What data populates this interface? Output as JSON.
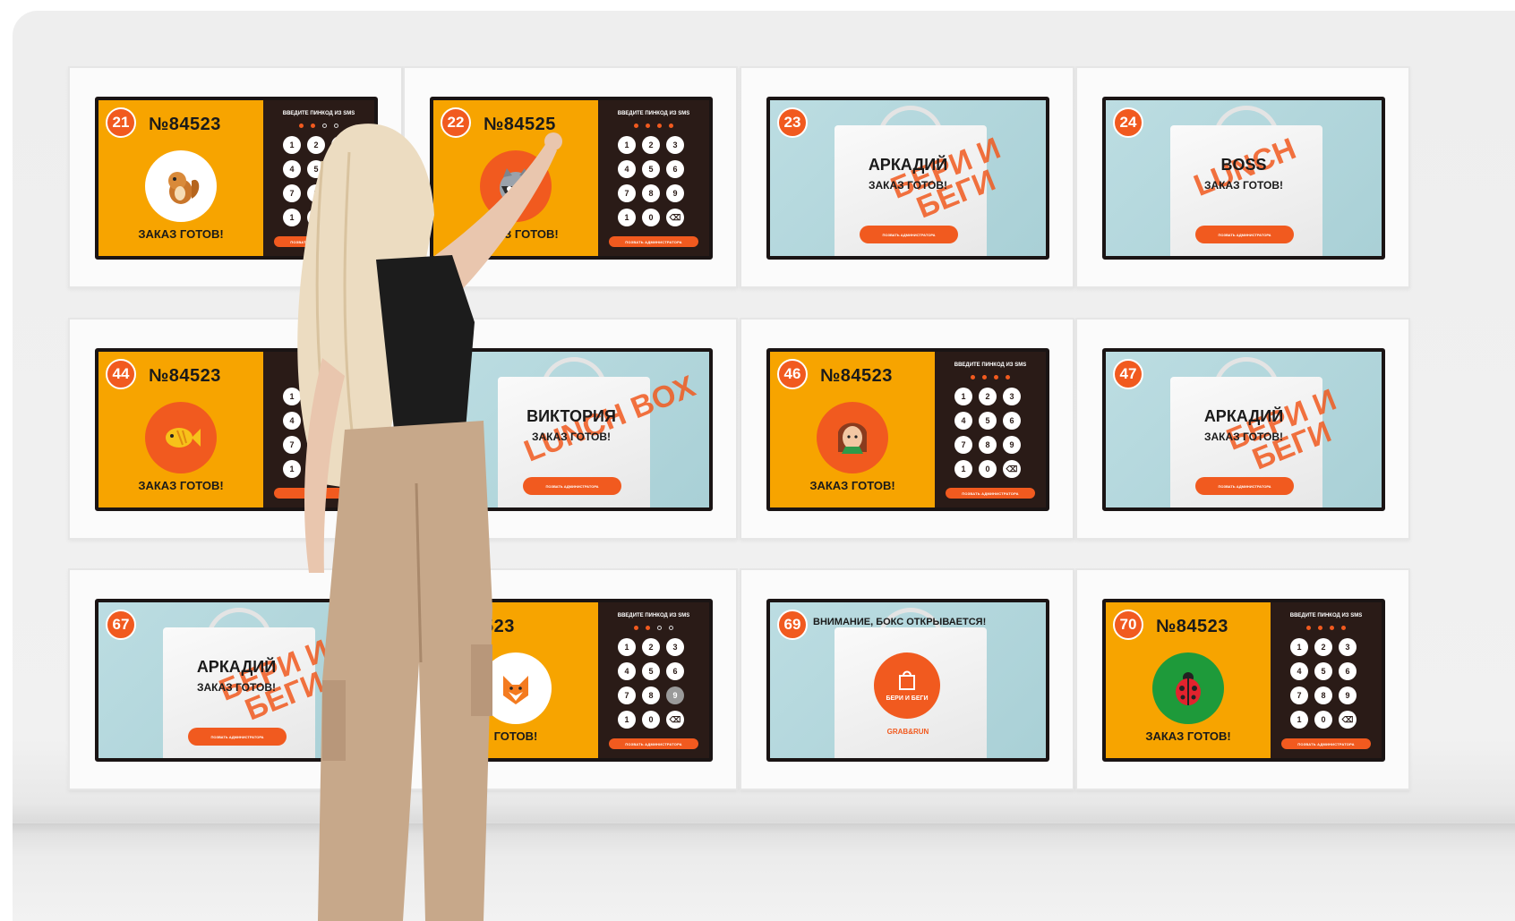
{
  "screens": [
    {
      "type": "order",
      "number": "21",
      "order": "№84523",
      "ready": "ЗАКАЗ ГОТОВ!",
      "avatar": "chipmunk-icon",
      "avatar_bg": "white",
      "pin_title": "ВВЕДИТЕ ПИНКОД ИЗ SMS",
      "dots": [
        1,
        1,
        0,
        0
      ],
      "pressed": "9",
      "admin": "ПОЗВАТЬ АДМИНИСТРАТОРА"
    },
    {
      "type": "order",
      "number": "22",
      "order": "№84525",
      "ready": "ЗАКАЗ ГОТОВ!",
      "avatar": "raccoon-icon",
      "avatar_bg": "orange",
      "pin_title": "ВВЕДИТЕ ПИНКОД ИЗ SMS",
      "dots": [
        1,
        1,
        1,
        1
      ],
      "pressed": "",
      "admin": "ПОЗВАТЬ АДМИНИСТРАТОРА"
    },
    {
      "type": "bag",
      "number": "23",
      "name": "АРКАДИЙ",
      "ready": "ЗАКАЗ ГОТОВ!",
      "brand": "БЕРИ И БЕГИ",
      "admin": "ПОЗВАТЬ АДМИНИСТРАТОРА"
    },
    {
      "type": "bag",
      "number": "24",
      "name": "BOSS",
      "ready": "ЗАКАЗ ГОТОВ!",
      "brand": "LUNCH",
      "admin": "ПОЗВАТЬ АДМИНИСТРАТОРА"
    },
    {
      "type": "order",
      "number": "44",
      "order": "№84523",
      "ready": "ЗАКАЗ ГОТОВ!",
      "avatar": "fish-icon",
      "avatar_bg": "orange",
      "pin_title": "ВВЕДИ",
      "dots": [],
      "pressed": "9",
      "admin": "ПОЗВА"
    },
    {
      "type": "bag",
      "number": "",
      "name": "ВИКТОРИЯ",
      "ready": "ЗАКАЗ ГОТОВ!",
      "brand": "LUNCH BOX",
      "admin": "ПОЗВАТЬ АДМИНИСТРАТОРА"
    },
    {
      "type": "order",
      "number": "46",
      "order": "№84523",
      "ready": "ЗАКАЗ ГОТОВ!",
      "avatar": "elf-icon",
      "avatar_bg": "orange",
      "pin_title": "ВВЕДИТЕ ПИНКОД ИЗ SMS",
      "dots": [
        1,
        1,
        1,
        1
      ],
      "pressed": "",
      "admin": "ПОЗВАТЬ АДМИНИСТРАТОРА"
    },
    {
      "type": "bag",
      "number": "47",
      "name": "АРКАДИЙ",
      "ready": "ЗАКАЗ ГОТОВ!",
      "brand": "БЕРИ И БЕГИ",
      "admin": "ПОЗВАТЬ АДМИНИСТРАТОРА"
    },
    {
      "type": "bag",
      "number": "67",
      "name": "АРКАДИЙ",
      "ready": "ЗАКАЗ ГОТОВ!",
      "brand": "БЕРИ И БЕГИ",
      "admin": "ПОЗВАТЬ АДМИНИСТРАТОРА"
    },
    {
      "type": "order",
      "number": "",
      "order": "523",
      "ready": "ГОТОВ!",
      "avatar": "fox-icon",
      "avatar_bg": "white",
      "pin_title": "ВВЕДИТЕ ПИНКОД ИЗ SMS",
      "dots": [
        1,
        1,
        0,
        0
      ],
      "pressed": "9",
      "admin": "ПОЗВАТЬ АДМИНИСТРАТОРА"
    },
    {
      "type": "opening",
      "number": "69",
      "notice": "ВНИМАНИЕ, БОКС ОТКРЫВАЕТСЯ!",
      "circle_text": "БЕРИ И БЕГИ",
      "brand": "GRAB&RUN"
    },
    {
      "type": "order",
      "number": "70",
      "order": "№84523",
      "ready": "ЗАКАЗ ГОТОВ!",
      "avatar": "ladybug-icon",
      "avatar_bg": "green",
      "pin_title": "ВВЕДИТЕ ПИНКОД ИЗ SMS",
      "dots": [
        1,
        1,
        1,
        1
      ],
      "pressed": "",
      "admin": "ПОЗВАТЬ АДМИНИСТРАТОРА"
    }
  ],
  "keys": [
    "1",
    "2",
    "3",
    "4",
    "5",
    "6",
    "7",
    "8",
    "9",
    "1",
    "0",
    "⌫"
  ],
  "colors": {
    "accent": "#f15a1f",
    "orange": "#f7a400",
    "dark": "#2a1b17",
    "bag_bg": "#bcdde2"
  }
}
